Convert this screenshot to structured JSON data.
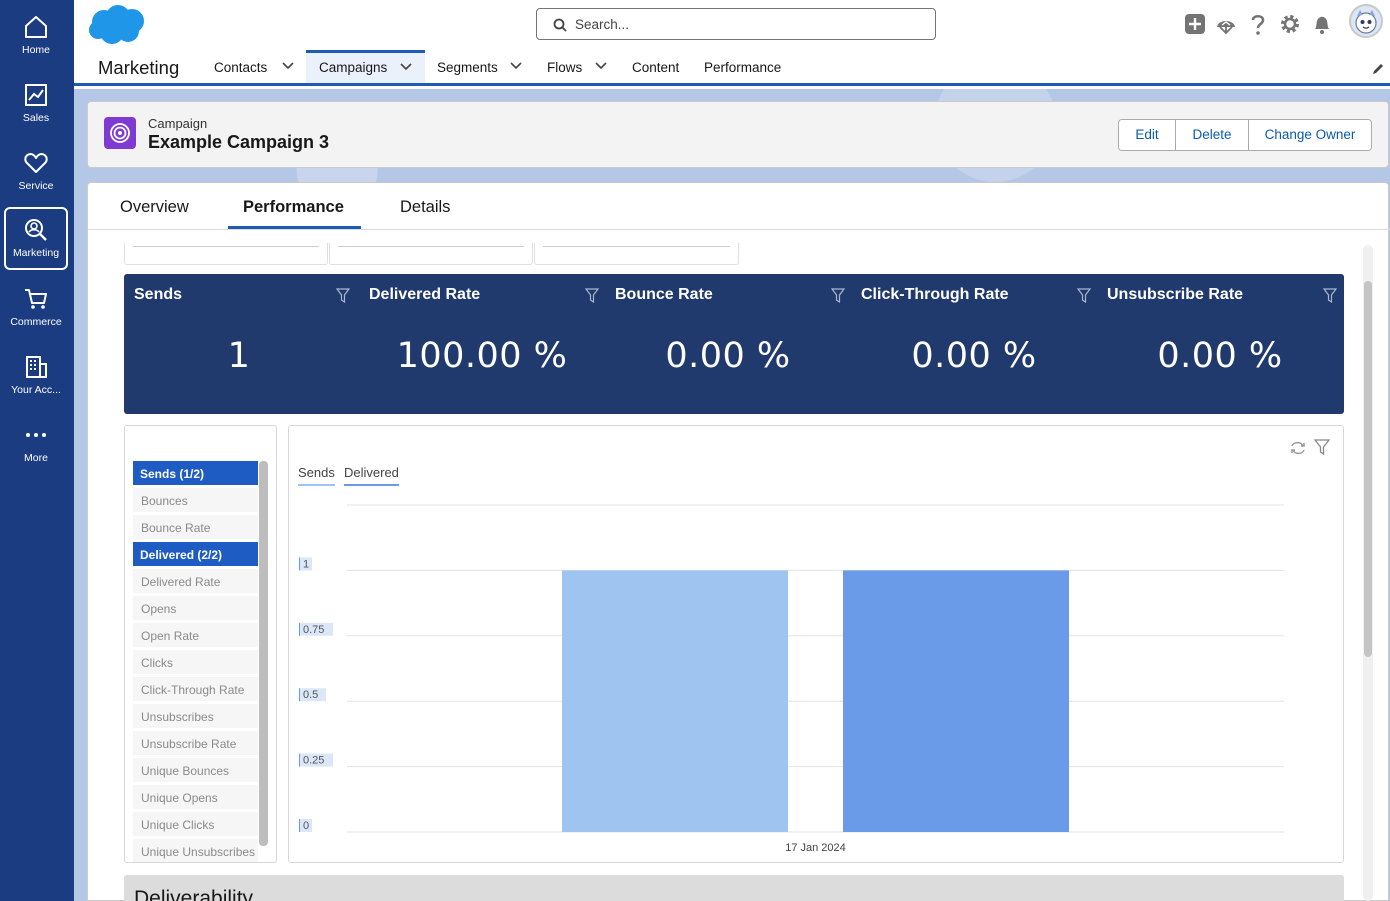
{
  "rail": {
    "items": [
      {
        "label": "Home",
        "icon": "home-icon"
      },
      {
        "label": "Sales",
        "icon": "chart-icon"
      },
      {
        "label": "Service",
        "icon": "heart-icon"
      },
      {
        "label": "Marketing",
        "icon": "marketing-icon",
        "active": true
      },
      {
        "label": "Commerce",
        "icon": "cart-icon"
      },
      {
        "label": "Your Acc...",
        "icon": "building-icon"
      },
      {
        "label": "More",
        "icon": "more-icon"
      }
    ]
  },
  "header": {
    "search_placeholder": "Search..."
  },
  "nav": {
    "app_name": "Marketing",
    "items": [
      {
        "label": "Contacts",
        "dropdown": true
      },
      {
        "label": "Campaigns",
        "dropdown": true,
        "active": true
      },
      {
        "label": "Segments",
        "dropdown": true
      },
      {
        "label": "Flows",
        "dropdown": true
      },
      {
        "label": "Content",
        "dropdown": false
      },
      {
        "label": "Performance",
        "dropdown": false
      }
    ]
  },
  "record": {
    "type": "Campaign",
    "name": "Example Campaign 3",
    "buttons": [
      "Edit",
      "Delete",
      "Change Owner"
    ]
  },
  "tabs": [
    "Overview",
    "Performance",
    "Details"
  ],
  "active_tab": "Performance",
  "kpis": [
    {
      "title": "Sends",
      "value": "1"
    },
    {
      "title": "Delivered Rate",
      "value": "100.00 %"
    },
    {
      "title": "Bounce Rate",
      "value": "0.00 %"
    },
    {
      "title": "Click-Through Rate",
      "value": "0.00 %"
    },
    {
      "title": "Unsubscribe Rate",
      "value": "0.00 %"
    }
  ],
  "metrics": [
    {
      "label": "Sends (1/2)",
      "selected": true
    },
    {
      "label": "Bounces",
      "selected": false
    },
    {
      "label": "Bounce Rate",
      "selected": false
    },
    {
      "label": "Delivered (2/2)",
      "selected": true
    },
    {
      "label": "Delivered Rate",
      "selected": false
    },
    {
      "label": "Opens",
      "selected": false
    },
    {
      "label": "Open Rate",
      "selected": false
    },
    {
      "label": "Clicks",
      "selected": false
    },
    {
      "label": "Click-Through Rate",
      "selected": false
    },
    {
      "label": "Unsubscribes",
      "selected": false
    },
    {
      "label": "Unsubscribe Rate",
      "selected": false
    },
    {
      "label": "Unique Bounces",
      "selected": false
    },
    {
      "label": "Unique Opens",
      "selected": false
    },
    {
      "label": "Unique Clicks",
      "selected": false
    },
    {
      "label": "Unique Unsubscribes",
      "selected": false
    }
  ],
  "chart_data": {
    "type": "bar",
    "categories": [
      "17 Jan 2024"
    ],
    "series": [
      {
        "name": "Sends",
        "values": [
          1
        ],
        "color": "#a0c4f0"
      },
      {
        "name": "Delivered",
        "values": [
          1
        ],
        "color": "#6a9be8"
      }
    ],
    "yticks": [
      "0",
      "0.25",
      "0.5",
      "0.75",
      "1"
    ],
    "ylim": [
      0,
      1.25
    ],
    "grid": true,
    "legend": "top-left"
  },
  "section": {
    "title": "Deliverability"
  },
  "colors": {
    "rail": "#1b3c80",
    "kpi_banner": "#213a6d",
    "accent": "#1e5bb5"
  }
}
